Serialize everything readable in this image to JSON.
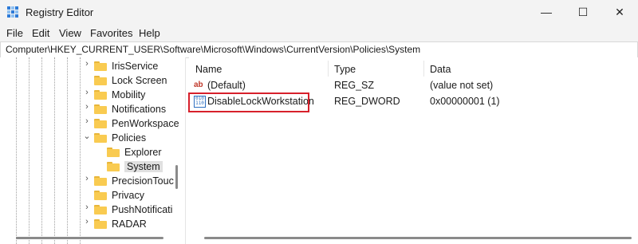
{
  "window": {
    "title": "Registry Editor",
    "controls": {
      "minimize": "—",
      "maximize": "☐",
      "close": "✕"
    }
  },
  "menu": [
    "File",
    "Edit",
    "View",
    "Favorites",
    "Help"
  ],
  "address": "Computer\\HKEY_CURRENT_USER\\Software\\Microsoft\\Windows\\CurrentVersion\\Policies\\System",
  "tree": {
    "items": [
      {
        "label": "IrisService",
        "expander": "›"
      },
      {
        "label": "Lock Screen",
        "expander": ""
      },
      {
        "label": "Mobility",
        "expander": "›"
      },
      {
        "label": "Notifications",
        "expander": "›"
      },
      {
        "label": "PenWorkspace",
        "expander": "›"
      },
      {
        "label": "Policies",
        "expander": "⌄"
      },
      {
        "label": "Explorer",
        "expander": ""
      },
      {
        "label": "System",
        "expander": "",
        "selected": true
      },
      {
        "label": "PrecisionTouc",
        "expander": "›"
      },
      {
        "label": "Privacy",
        "expander": ""
      },
      {
        "label": "PushNotificati",
        "expander": "›"
      },
      {
        "label": "RADAR",
        "expander": "›"
      }
    ]
  },
  "list": {
    "columns": {
      "name": "Name",
      "type": "Type",
      "data": "Data"
    },
    "rows": [
      {
        "name": "(Default)",
        "type": "REG_SZ",
        "data": "(value not set)",
        "icon": "string-value-icon",
        "glyph": "ab"
      },
      {
        "name": "DisableLockWorkstation",
        "type": "REG_DWORD",
        "data": "0x00000001 (1)",
        "icon": "binary-value-icon",
        "glyph": "010 110"
      }
    ]
  },
  "colors": {
    "highlight": "#d7202b",
    "folder": "#f9cb51",
    "selection": "#e0e0e0"
  }
}
